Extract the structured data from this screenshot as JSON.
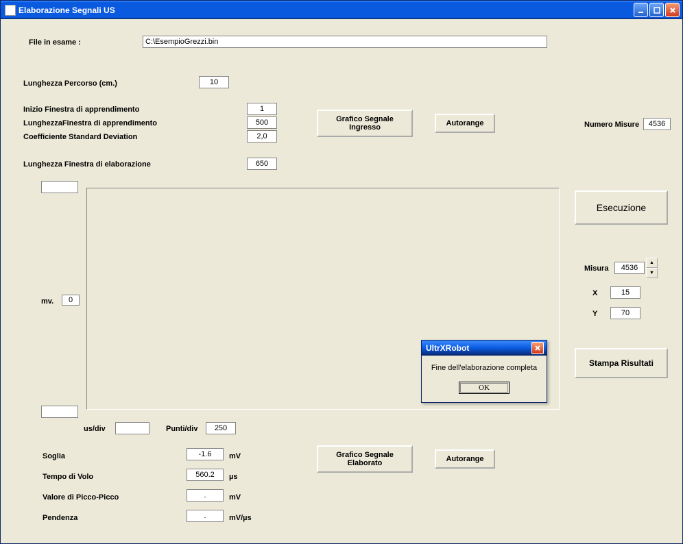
{
  "window": {
    "title": "Elaborazione Segnali US"
  },
  "file": {
    "label": "File in esame :",
    "value": "C:\\EsempioGrezzi.bin"
  },
  "params": {
    "lunghezza_percorso_label": "Lunghezza Percorso (cm.)",
    "lunghezza_percorso": "10",
    "inizio_finestra_label": "Inizio Finestra di apprendimento",
    "inizio_finestra": "1",
    "lunghezza_finestra_appr_label": "LunghezzaFinestra di apprendimento",
    "lunghezza_finestra_appr": "500",
    "coeff_std_label": "Coefficiente Standard Deviation",
    "coeff_std": "2,0",
    "lunghezza_finestra_elab_label": "Lunghezza Finestra di elaborazione",
    "lunghezza_finestra_elab": "650"
  },
  "topbtns": {
    "grafico_ingresso": "Grafico Segnale Ingresso",
    "autorange1": "Autorange",
    "numero_misure_label": "Numero Misure",
    "numero_misure": "4536"
  },
  "graph1": {
    "mv_label": "mv.",
    "mv_value": "0",
    "top_box": "",
    "bottom_box": "",
    "usdiv_label": "us/div",
    "usdiv_value": "",
    "puntidiv_label": "Punti/div",
    "puntidiv_value": "250"
  },
  "side": {
    "esecuzione": "Esecuzione",
    "misura_label": "Misura",
    "misura_value": "4536",
    "x_label": "X",
    "x_value": "15",
    "y_label": "Y",
    "y_value": "70",
    "stampa": "Stampa Risultati"
  },
  "bottom": {
    "soglia_label": "Soglia",
    "soglia_value": "-1.6",
    "soglia_unit": "mV",
    "tempo_label": "Tempo di Volo",
    "tempo_value": "560.2",
    "tempo_unit": "µs",
    "picco_label": "Valore di Picco-Picco",
    "picco_value": ".",
    "picco_unit": "mV",
    "pendenza_label": "Pendenza",
    "pendenza_value": ".",
    "pendenza_unit": "mV/µs",
    "grafico_elab": "Grafico Segnale Elaborato",
    "autorange2": "Autorange"
  },
  "dialog": {
    "title": "UltrXRobot",
    "msg": "Fine dell'elaborazione completa",
    "ok": "OK"
  }
}
